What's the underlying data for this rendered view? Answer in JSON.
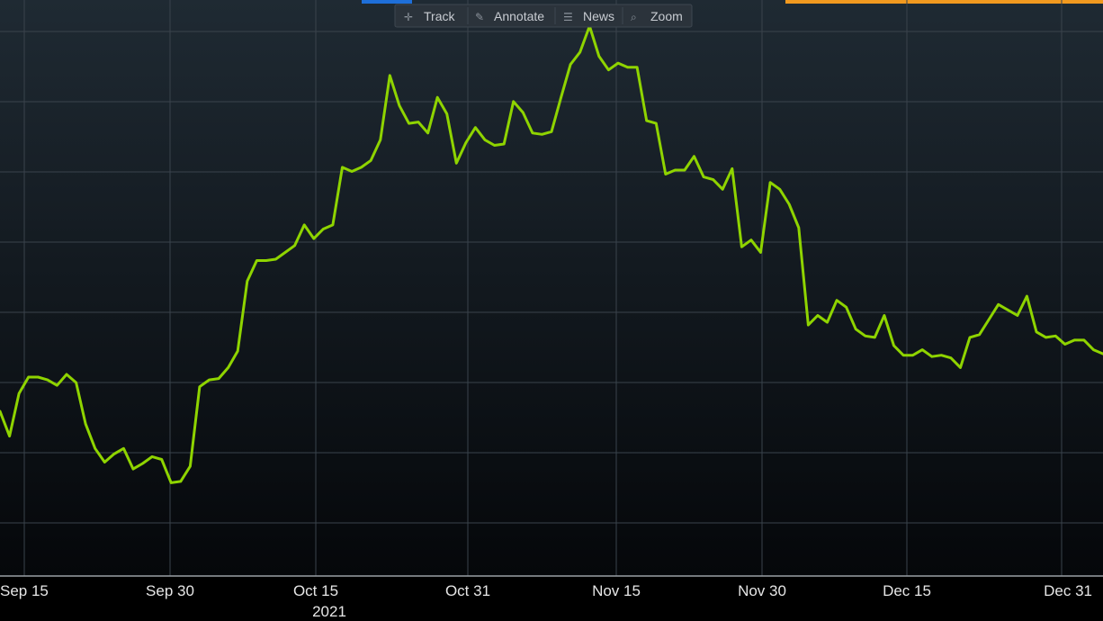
{
  "toolbar": {
    "items": [
      {
        "label": "Track",
        "icon": "crosshair-icon",
        "glyph": "✛"
      },
      {
        "label": "Annotate",
        "icon": "pencil-icon",
        "glyph": "✎"
      },
      {
        "label": "News",
        "icon": "news-icon",
        "glyph": "☰"
      },
      {
        "label": "Zoom",
        "icon": "magnifier-icon",
        "glyph": "⌕"
      }
    ]
  },
  "colors": {
    "background_top": "#1f2a33",
    "background_bottom": "#05070a",
    "grid": "#3a434c",
    "line": "#8fd400",
    "accent_orange": "#f29a1f",
    "accent_blue": "#1e6fd9",
    "axis_text": "#e6e6e6"
  },
  "chart_data": {
    "type": "line",
    "grid": true,
    "year_label": "2021",
    "x_ticks": [
      "Sep 15",
      "Sep 30",
      "Oct 15",
      "Oct 31",
      "Nov 15",
      "Nov 30",
      "Dec 15",
      "Dec 31"
    ],
    "y_ticks_visible": false,
    "series": [
      {
        "values": [
          42.0,
          40.2,
          43.3,
          44.5,
          44.5,
          44.3,
          43.9,
          44.7,
          44.1,
          41.1,
          39.3,
          38.3,
          38.9,
          39.3,
          37.8,
          38.2,
          38.7,
          38.5,
          36.8,
          36.9,
          38.0,
          43.8,
          44.3,
          44.4,
          45.2,
          46.4,
          51.5,
          53.0,
          53.0,
          53.1,
          53.6,
          54.1,
          55.6,
          54.6,
          55.3,
          55.6,
          59.8,
          59.5,
          59.8,
          60.3,
          61.8,
          66.5,
          64.3,
          63.0,
          63.1,
          62.3,
          64.9,
          63.7,
          60.1,
          61.6,
          62.7,
          61.8,
          61.4,
          61.5,
          64.6,
          63.8,
          62.3,
          62.2,
          62.4,
          64.9,
          67.3,
          68.2,
          70.1,
          67.9,
          66.9,
          67.4,
          67.1,
          67.1,
          63.2,
          63.0,
          59.3,
          59.6,
          59.6,
          60.6,
          59.1,
          58.9,
          58.2,
          59.7,
          54.0,
          54.5,
          53.6,
          58.7,
          58.2,
          57.1,
          55.4,
          48.3,
          49.0,
          48.5,
          50.1,
          49.6,
          48.0,
          47.5,
          47.4,
          49.0,
          46.8,
          46.1,
          46.1,
          46.5,
          46.0,
          46.1,
          45.9,
          45.2,
          47.4,
          47.6,
          48.7,
          49.8,
          49.4,
          49.0,
          50.4,
          47.8,
          47.4,
          47.5,
          46.9,
          47.2,
          47.2,
          46.5,
          46.2
        ]
      }
    ]
  }
}
